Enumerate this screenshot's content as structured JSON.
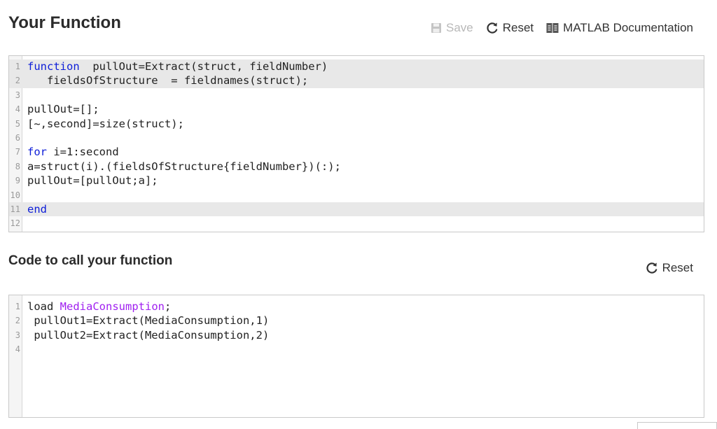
{
  "function_section": {
    "title": "Your Function",
    "toolbar": {
      "save_label": "Save",
      "reset_label": "Reset",
      "docs_label": "MATLAB Documentation"
    }
  },
  "function_editor": {
    "line_numbers": [
      "1",
      "2",
      "3",
      "4",
      "5",
      "6",
      "7",
      "8",
      "9",
      "10",
      "11",
      "12"
    ],
    "lines": [
      [
        {
          "t": "function",
          "k": "kw"
        },
        {
          "t": "  pullOut=Extract(struct, fieldNumber)"
        }
      ],
      [
        {
          "t": "   fieldsOfStructure  = fieldnames(struct);"
        }
      ],
      [
        {
          "t": ""
        }
      ],
      [
        {
          "t": "pullOut=[];"
        }
      ],
      [
        {
          "t": "[~,second]=size(struct);"
        }
      ],
      [
        {
          "t": ""
        }
      ],
      [
        {
          "t": "for",
          "k": "kw"
        },
        {
          "t": " i=1:second"
        }
      ],
      [
        {
          "t": "a=struct(i).(fieldsOfStructure{fieldNumber})(:);"
        }
      ],
      [
        {
          "t": "pullOut=[pullOut;a];"
        }
      ],
      [
        {
          "t": ""
        }
      ],
      [
        {
          "t": "end",
          "k": "kw"
        }
      ],
      [
        {
          "t": ""
        }
      ]
    ],
    "highlighted_lines": [
      1,
      2,
      11
    ]
  },
  "call_section": {
    "title": "Code to call your function",
    "reset_label": "Reset"
  },
  "call_editor": {
    "line_numbers": [
      "1",
      "2",
      "3",
      "4"
    ],
    "lines": [
      [
        {
          "t": "load "
        },
        {
          "t": "MediaConsumption",
          "k": "str"
        },
        {
          "t": ";"
        }
      ],
      [
        {
          "t": " pullOut1=Extract(MediaConsumption,1)"
        }
      ],
      [
        {
          "t": " pullOut2=Extract(MediaConsumption,2)"
        }
      ],
      [
        {
          "t": ""
        }
      ]
    ],
    "highlighted_lines": []
  },
  "colors": {
    "keyword": "#0e1ed8",
    "string": "#a020f0",
    "highlight": "#e8e8e8"
  }
}
